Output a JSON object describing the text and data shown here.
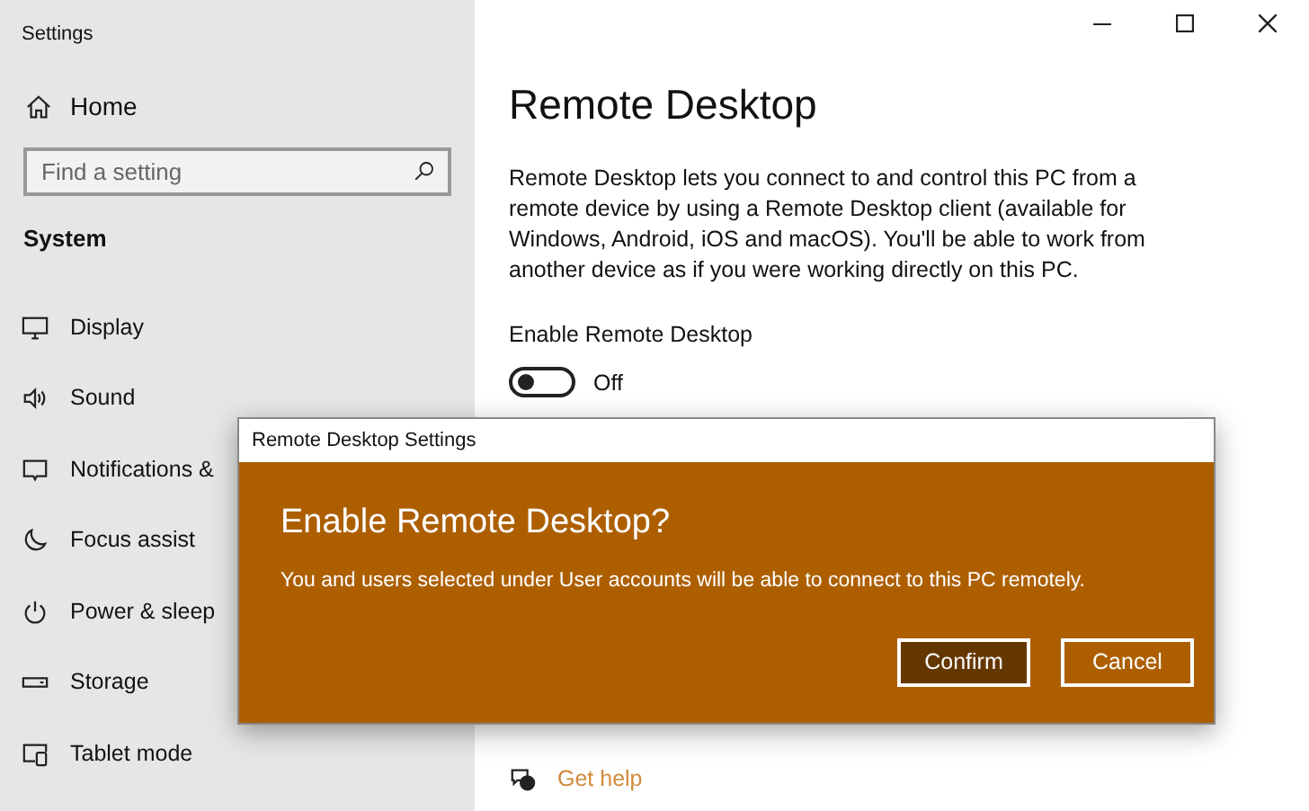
{
  "window": {
    "title": "Settings"
  },
  "sidebar": {
    "home": "Home",
    "search": {
      "placeholder": "Find a setting"
    },
    "section": "System",
    "items": [
      {
        "label": "Display"
      },
      {
        "label": "Sound"
      },
      {
        "label": "Notifications &"
      },
      {
        "label": "Focus assist"
      },
      {
        "label": "Power & sleep"
      },
      {
        "label": "Storage"
      },
      {
        "label": "Tablet mode"
      }
    ]
  },
  "main": {
    "title": "Remote Desktop",
    "description": "Remote Desktop lets you connect to and control this PC from a remote device by using a Remote Desktop client (available for Windows, Android, iOS and macOS). You'll be able to work from another device as if you were working directly on this PC.",
    "toggle": {
      "label": "Enable Remote Desktop",
      "on": false,
      "state_text": "Off"
    },
    "help_link": "Get help"
  },
  "dialog": {
    "title": "Remote Desktop Settings",
    "heading": "Enable Remote Desktop?",
    "message": "You and users selected under User accounts will be able to connect to this PC remotely.",
    "buttons": [
      {
        "label": "Confirm",
        "default": true
      },
      {
        "label": "Cancel",
        "default": false
      }
    ]
  }
}
